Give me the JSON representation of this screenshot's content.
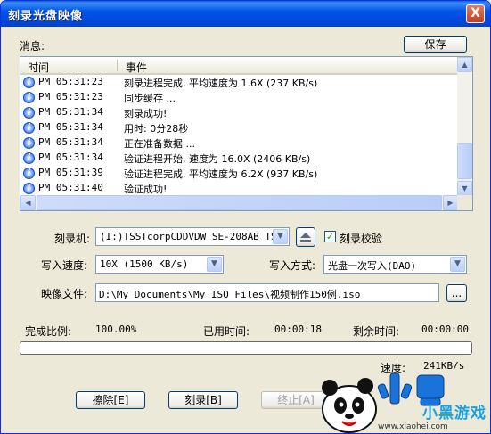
{
  "window": {
    "title": "刻录光盘映像",
    "close_glyph": "X"
  },
  "messages": {
    "label": "消息:",
    "save_label": "保存",
    "columns": {
      "time": "时间",
      "event": "事件"
    },
    "rows": [
      {
        "time": "PM 05:31:23",
        "event": "刻录进程完成, 平均速度为 1.6X (237 KB/s)"
      },
      {
        "time": "PM 05:31:23",
        "event": "同步缓存 ..."
      },
      {
        "time": "PM 05:31:34",
        "event": "刻录成功!"
      },
      {
        "time": "PM 05:31:34",
        "event": "用时: 0分28秒"
      },
      {
        "time": "PM 05:31:34",
        "event": "正在准备数据 ..."
      },
      {
        "time": "PM 05:31:34",
        "event": "验证进程开始, 速度为 16.0X (2406 KB/s)"
      },
      {
        "time": "PM 05:31:39",
        "event": "验证进程完成, 平均速度为 6.2X (937 KB/s)"
      },
      {
        "time": "PM 05:31:40",
        "event": "验证成功!"
      }
    ],
    "info_icon_glyph": "i"
  },
  "form": {
    "burner_label": "刻录机:",
    "burner_value": "(I:)TSSTcorpCDDVDW SE-208AB TS03",
    "verify_label": "刻录校验",
    "verify_checked": true,
    "speed_label": "写入速度:",
    "speed_value": "10X (1500 KB/s)",
    "mode_label": "写入方式:",
    "mode_value": "光盘一次写入(DAO)",
    "image_label": "映像文件:",
    "image_value": "D:\\My Documents\\My ISO Files\\视频制作150例.iso",
    "browse_label": "..."
  },
  "status": {
    "complete_label": "完成比例:",
    "complete_value": "100.00%",
    "elapsed_label": "已用时间:",
    "elapsed_value": "00:00:18",
    "remaining_label": "剩余时间:",
    "remaining_value": "00:00:00",
    "speed_label": "速度:",
    "speed_value": "241KB/s",
    "progress_fraction": 0
  },
  "buttons": {
    "erase": "擦除[E]",
    "burn": "刻录[B]",
    "stop": "终止[A]"
  },
  "watermark": {
    "brand": "小黑游戏",
    "url": "www.xiaohei.com"
  },
  "colors": {
    "titlebar": "#0055e5",
    "dialog_bg": "#ece9d8",
    "list_border": "#7f9db9",
    "check": "#21a121"
  }
}
